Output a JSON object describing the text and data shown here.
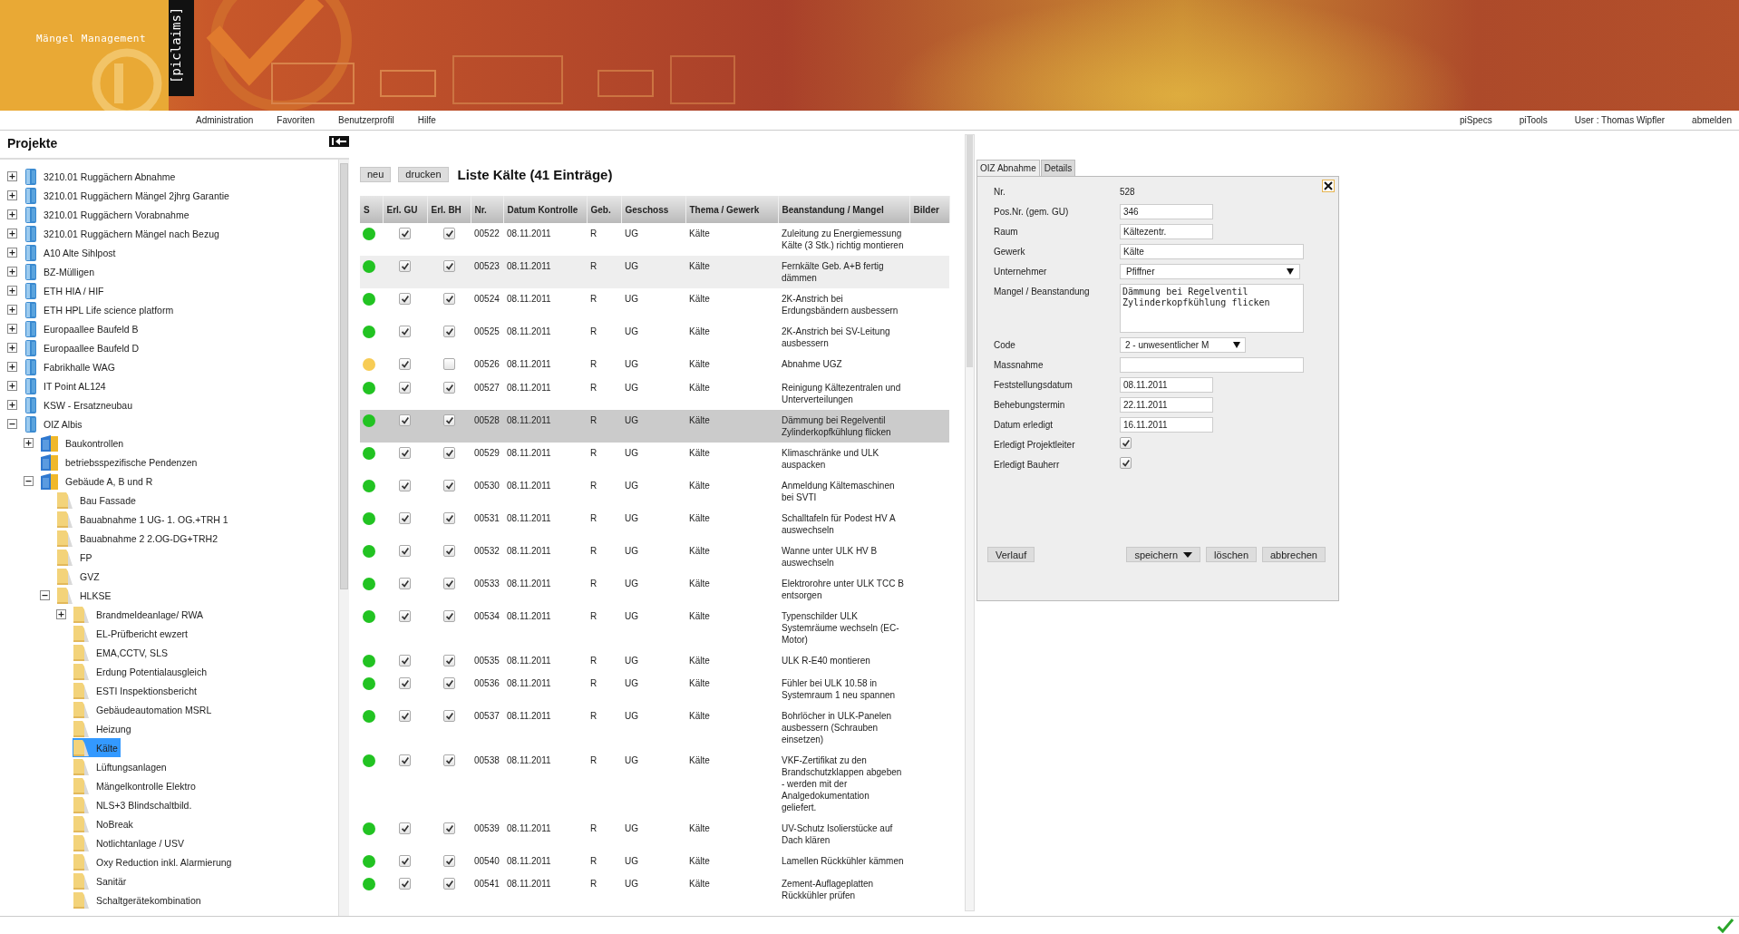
{
  "header": {
    "app_title": "Mängel Management",
    "logo": "[piclaims]"
  },
  "menu": {
    "left": [
      "Administration",
      "Favoriten",
      "Benutzerprofil",
      "Hilfe"
    ],
    "right": {
      "links": [
        "piSpecs",
        "piTools"
      ],
      "user": "User : Thomas Wipfler",
      "logout": "abmelden"
    }
  },
  "sidebar": {
    "title": "Projekte",
    "tree": [
      {
        "label": "3210.01 Ruggächern Abnahme",
        "expanded": false,
        "selected": false
      },
      {
        "label": "3210.01 Ruggächern Mängel 2jhrg Garantie",
        "expanded": false,
        "selected": false
      },
      {
        "label": "3210.01 Ruggächern Vorabnahme",
        "expanded": false,
        "selected": false
      },
      {
        "label": "3210.01 Ruggächern Mängel nach Bezug",
        "expanded": false,
        "selected": false
      },
      {
        "label": "A10 Alte Sihlpost",
        "expanded": false,
        "selected": false
      },
      {
        "label": "BZ-Mülligen",
        "expanded": false,
        "selected": false
      },
      {
        "label": "ETH HIA / HIF",
        "expanded": false,
        "selected": false
      },
      {
        "label": "ETH HPL Life science platform",
        "expanded": false,
        "selected": false
      },
      {
        "label": "Europaallee Baufeld B",
        "expanded": false,
        "selected": false
      },
      {
        "label": "Europaallee Baufeld D",
        "expanded": false,
        "selected": false
      },
      {
        "label": "Fabrikhalle WAG",
        "expanded": false,
        "selected": false
      },
      {
        "label": "IT Point AL124",
        "expanded": false,
        "selected": false
      },
      {
        "label": "KSW - Ersatzneubau",
        "expanded": false,
        "selected": false
      },
      {
        "label": "OIZ Albis",
        "expanded": true,
        "selected": false,
        "children": [
          {
            "label": "Baukontrollen",
            "expanded": false,
            "selected": false
          },
          {
            "label": "betriebsspezifische Pendenzen",
            "selected": false
          },
          {
            "label": "Gebäude A, B und R",
            "expanded": true,
            "selected": false,
            "children": [
              {
                "label": "Bau Fassade",
                "selected": false
              },
              {
                "label": "Bauabnahme 1 UG- 1. OG.+TRH 1",
                "selected": false
              },
              {
                "label": "Bauabnahme 2 2.OG-DG+TRH2",
                "selected": false
              },
              {
                "label": "FP",
                "selected": false
              },
              {
                "label": "GVZ",
                "selected": false
              },
              {
                "label": "HLKSE",
                "expanded": true,
                "selected": false,
                "children": [
                  {
                    "label": "Brandmeldeanlage/ RWA",
                    "expanded": false,
                    "selected": false
                  },
                  {
                    "label": "EL-Prüfbericht ewzert",
                    "selected": false
                  },
                  {
                    "label": "EMA,CCTV, SLS",
                    "selected": false
                  },
                  {
                    "label": "Erdung Potentialausgleich",
                    "selected": false
                  },
                  {
                    "label": "ESTI Inspektionsbericht",
                    "selected": false
                  },
                  {
                    "label": "Gebäudeautomation MSRL",
                    "selected": false
                  },
                  {
                    "label": "Heizung",
                    "selected": false
                  },
                  {
                    "label": "Kälte",
                    "selected": true
                  },
                  {
                    "label": "Lüftungsanlagen",
                    "selected": false
                  },
                  {
                    "label": "Mängelkontrolle Elektro",
                    "selected": false
                  },
                  {
                    "label": "NLS+3 Blindschaltbild.",
                    "selected": false
                  },
                  {
                    "label": "NoBreak",
                    "selected": false
                  },
                  {
                    "label": "Notlichtanlage / USV",
                    "selected": false
                  },
                  {
                    "label": "Oxy Reduction inkl. Alarmierung",
                    "selected": false
                  },
                  {
                    "label": "Sanitär",
                    "selected": false
                  },
                  {
                    "label": "Schaltgerätekombination",
                    "selected": false
                  }
                ]
              }
            ]
          }
        ]
      }
    ]
  },
  "list": {
    "buttons": [
      "neu",
      "drucken"
    ],
    "title": "Liste Kälte (41 Einträge)",
    "columns": [
      "S",
      "Erl. GU",
      "Erl. BH",
      "Nr.",
      "Datum Kontrolle",
      "Geb.",
      "Geschoss",
      "Thema / Gewerk",
      "Beanstandung / Mangel",
      "Bilder"
    ],
    "rows": [
      {
        "color": "#22c322",
        "erl_gu": true,
        "erl_bh": true,
        "nr": "00522",
        "date": "08.11.2011",
        "geb": "R",
        "geschoss": "UG",
        "thema": "Kälte",
        "mangel": "Zuleitung zu Energiemessung Kälte (3 Stk.) richtig montieren",
        "selected": false,
        "hover": false
      },
      {
        "color": "#22c322",
        "erl_gu": true,
        "erl_bh": true,
        "nr": "00523",
        "date": "08.11.2011",
        "geb": "R",
        "geschoss": "UG",
        "thema": "Kälte",
        "mangel": "Fernkälte Geb. A+B fertig dämmen",
        "selected": false,
        "hover": true
      },
      {
        "color": "#22c322",
        "erl_gu": true,
        "erl_bh": true,
        "nr": "00524",
        "date": "08.11.2011",
        "geb": "R",
        "geschoss": "UG",
        "thema": "Kälte",
        "mangel": "2K-Anstrich bei Erdungsbändern ausbessern",
        "selected": false,
        "hover": false
      },
      {
        "color": "#22c322",
        "erl_gu": true,
        "erl_bh": true,
        "nr": "00525",
        "date": "08.11.2011",
        "geb": "R",
        "geschoss": "UG",
        "thema": "Kälte",
        "mangel": "2K-Anstrich bei SV-Leitung ausbessern",
        "selected": false,
        "hover": false
      },
      {
        "color": "#f7cc55",
        "erl_gu": true,
        "erl_bh": false,
        "nr": "00526",
        "date": "08.11.2011",
        "geb": "R",
        "geschoss": "UG",
        "thema": "Kälte",
        "mangel": "Abnahme UGZ",
        "selected": false,
        "hover": false
      },
      {
        "color": "#22c322",
        "erl_gu": true,
        "erl_bh": true,
        "nr": "00527",
        "date": "08.11.2011",
        "geb": "R",
        "geschoss": "UG",
        "thema": "Kälte",
        "mangel": "Reinigung Kältezentralen und Unterverteilungen",
        "selected": false,
        "hover": false
      },
      {
        "color": "#22c322",
        "erl_gu": true,
        "erl_bh": true,
        "nr": "00528",
        "date": "08.11.2011",
        "geb": "R",
        "geschoss": "UG",
        "thema": "Kälte",
        "mangel": "Dämmung bei Regelventil Zylinderkopfkühlung flicken",
        "selected": true,
        "hover": false
      },
      {
        "color": "#22c322",
        "erl_gu": true,
        "erl_bh": true,
        "nr": "00529",
        "date": "08.11.2011",
        "geb": "R",
        "geschoss": "UG",
        "thema": "Kälte",
        "mangel": "Klimaschränke und ULK auspacken",
        "selected": false,
        "hover": false
      },
      {
        "color": "#22c322",
        "erl_gu": true,
        "erl_bh": true,
        "nr": "00530",
        "date": "08.11.2011",
        "geb": "R",
        "geschoss": "UG",
        "thema": "Kälte",
        "mangel": "Anmeldung Kältemaschinen bei SVTI",
        "selected": false,
        "hover": false
      },
      {
        "color": "#22c322",
        "erl_gu": true,
        "erl_bh": true,
        "nr": "00531",
        "date": "08.11.2011",
        "geb": "R",
        "geschoss": "UG",
        "thema": "Kälte",
        "mangel": "Schalltafeln für Podest HV A auswechseln",
        "selected": false,
        "hover": false
      },
      {
        "color": "#22c322",
        "erl_gu": true,
        "erl_bh": true,
        "nr": "00532",
        "date": "08.11.2011",
        "geb": "R",
        "geschoss": "UG",
        "thema": "Kälte",
        "mangel": "Wanne unter ULK HV B auswechseln",
        "selected": false,
        "hover": false
      },
      {
        "color": "#22c322",
        "erl_gu": true,
        "erl_bh": true,
        "nr": "00533",
        "date": "08.11.2011",
        "geb": "R",
        "geschoss": "UG",
        "thema": "Kälte",
        "mangel": "Elektrorohre unter ULK TCC B entsorgen",
        "selected": false,
        "hover": false
      },
      {
        "color": "#22c322",
        "erl_gu": true,
        "erl_bh": true,
        "nr": "00534",
        "date": "08.11.2011",
        "geb": "R",
        "geschoss": "UG",
        "thema": "Kälte",
        "mangel": "Typenschilder ULK Systemräume wechseln (EC-Motor)",
        "selected": false,
        "hover": false
      },
      {
        "color": "#22c322",
        "erl_gu": true,
        "erl_bh": true,
        "nr": "00535",
        "date": "08.11.2011",
        "geb": "R",
        "geschoss": "UG",
        "thema": "Kälte",
        "mangel": "ULK R-E40 montieren",
        "selected": false,
        "hover": false
      },
      {
        "color": "#22c322",
        "erl_gu": true,
        "erl_bh": true,
        "nr": "00536",
        "date": "08.11.2011",
        "geb": "R",
        "geschoss": "UG",
        "thema": "Kälte",
        "mangel": "Fühler bei ULK 10.58 in Systemraum 1 neu spannen",
        "selected": false,
        "hover": false
      },
      {
        "color": "#22c322",
        "erl_gu": true,
        "erl_bh": true,
        "nr": "00537",
        "date": "08.11.2011",
        "geb": "R",
        "geschoss": "UG",
        "thema": "Kälte",
        "mangel": "Bohrlöcher in ULK-Panelen ausbessern (Schrauben einsetzen)",
        "selected": false,
        "hover": false
      },
      {
        "color": "#22c322",
        "erl_gu": true,
        "erl_bh": true,
        "nr": "00538",
        "date": "08.11.2011",
        "geb": "R",
        "geschoss": "UG",
        "thema": "Kälte",
        "mangel": "VKF-Zertifikat zu den Brandschutzklappen abgeben - werden mit der Analgedokumentation geliefert.",
        "selected": false,
        "hover": false
      },
      {
        "color": "#22c322",
        "erl_gu": true,
        "erl_bh": true,
        "nr": "00539",
        "date": "08.11.2011",
        "geb": "R",
        "geschoss": "UG",
        "thema": "Kälte",
        "mangel": "UV-Schutz Isolierstücke auf Dach klären",
        "selected": false,
        "hover": false
      },
      {
        "color": "#22c322",
        "erl_gu": true,
        "erl_bh": true,
        "nr": "00540",
        "date": "08.11.2011",
        "geb": "R",
        "geschoss": "UG",
        "thema": "Kälte",
        "mangel": "Lamellen Rückkühler kämmen",
        "selected": false,
        "hover": false
      },
      {
        "color": "#22c322",
        "erl_gu": true,
        "erl_bh": true,
        "nr": "00541",
        "date": "08.11.2011",
        "geb": "R",
        "geschoss": "UG",
        "thema": "Kälte",
        "mangel": "Zement-Auflageplatten Rückkühler prüfen",
        "selected": false,
        "hover": false
      }
    ]
  },
  "detail": {
    "tabs": [
      {
        "label": "OIZ Abnahme",
        "selected": true
      },
      {
        "label": "Details",
        "selected": false
      }
    ],
    "fields": [
      {
        "label": "Nr.",
        "kind": "text",
        "value": "528"
      },
      {
        "label": "Pos.Nr. (gem. GU)",
        "kind": "short",
        "value": "346"
      },
      {
        "label": "Raum",
        "kind": "short",
        "value": "Kältezentr."
      },
      {
        "label": "Gewerk",
        "kind": "long",
        "value": "Kälte"
      },
      {
        "label": "Unternehmer",
        "kind": "select",
        "value": "Pfiffner"
      },
      {
        "label": "Mangel / Beanstandung",
        "kind": "textarea",
        "value": "Dämmung bei Regelventil Zylinderkopfkühlung flicken"
      },
      {
        "label": "Code",
        "kind": "shortselect",
        "value": "2 - unwesentlicher M"
      },
      {
        "label": "Massnahme",
        "kind": "long"
      },
      {
        "label": "Feststellungsdatum",
        "kind": "short",
        "value": "08.11.2011"
      },
      {
        "label": "Behebungstermin",
        "kind": "short",
        "value": "22.11.2011"
      },
      {
        "label": "Datum erledigt",
        "kind": "short",
        "value": "16.11.2011"
      },
      {
        "label": "Erledigt Projektleiter",
        "kind": "checkbox",
        "checked": true
      },
      {
        "label": "Erledigt Bauherr",
        "kind": "checkbox",
        "checked": true
      }
    ],
    "buttons": [
      {
        "label": "Verlauf",
        "kind": "plain"
      },
      {
        "label": "speichern",
        "kind": "split"
      },
      {
        "label": "löschen",
        "kind": "plain"
      },
      {
        "label": "abbrechen",
        "kind": "plain"
      }
    ]
  }
}
